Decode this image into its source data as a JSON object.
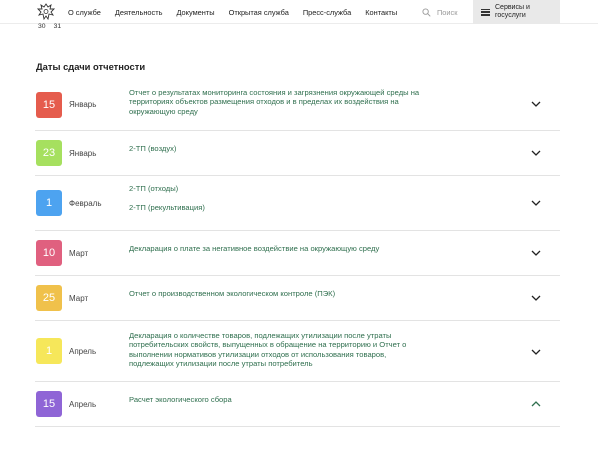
{
  "header": {
    "nav": [
      "О службе",
      "Деятельность",
      "Документы",
      "Открытая служба",
      "Пресс-служба",
      "Контакты"
    ],
    "search_label": "Поиск",
    "services_line1": "Сервисы и",
    "services_line2": "госуслуги"
  },
  "sub_numbers": [
    "30",
    "31"
  ],
  "section": {
    "title": "Даты сдачи отчетности"
  },
  "colors": {
    "red": "#e55c4d",
    "green": "#a6e05f",
    "blue": "#4da3f0",
    "pink": "#e0607f",
    "orange": "#f0c14b",
    "yellow": "#f6e75a",
    "purple": "#8f65d6",
    "link_green": "#2f6f4e"
  },
  "items": [
    {
      "day": "15",
      "month": "Январь",
      "color": "#e55c4d",
      "expanded": false,
      "lines": [
        "Отчет о результатах мониторинга состояния и загрязнения окружающей среды на",
        "территориях объектов размещения отходов и в пределах их воздействия на",
        "окружающую среду"
      ]
    },
    {
      "day": "23",
      "month": "Январь",
      "color": "#a6e05f",
      "expanded": false,
      "lines": [
        "2-ТП (воздух)"
      ]
    },
    {
      "day": "1",
      "month": "Февраль",
      "color": "#4da3f0",
      "expanded": false,
      "lines": [
        "2-ТП (отходы)",
        "2-ТП (рекультивация)"
      ]
    },
    {
      "day": "10",
      "month": "Март",
      "color": "#e0607f",
      "expanded": false,
      "lines": [
        "Декларация о плате за негативное воздействие на окружающую среду"
      ]
    },
    {
      "day": "25",
      "month": "Март",
      "color": "#f0c14b",
      "expanded": false,
      "lines": [
        "Отчет о производственном экологическом контроле (ПЭК)"
      ]
    },
    {
      "day": "1",
      "month": "Апрель",
      "color": "#f6e75a",
      "expanded": false,
      "lines": [
        "Декларация о количестве товаров, подлежащих утилизации после утраты",
        "потребительских свойств, выпущенных в обращение на территорию и Отчет о",
        "выполнении нормативов утилизации отходов от использования товаров,",
        "подлежащих утилизации после утраты потребитель"
      ]
    },
    {
      "day": "15",
      "month": "Апрель",
      "color": "#8f65d6",
      "expanded": true,
      "lines": [
        "Расчет экологического сбора"
      ]
    }
  ]
}
